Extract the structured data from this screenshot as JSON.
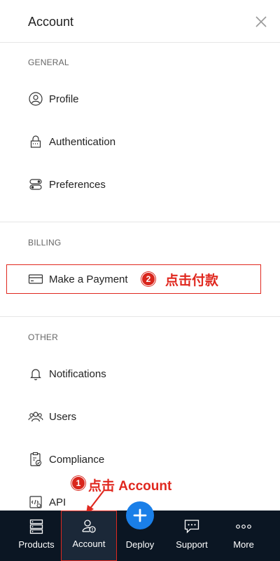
{
  "header": {
    "title": "Account"
  },
  "sections": {
    "general": {
      "label": "GENERAL",
      "items": [
        {
          "label": "Profile",
          "icon": "user-circle-icon"
        },
        {
          "label": "Authentication",
          "icon": "lock-icon"
        },
        {
          "label": "Preferences",
          "icon": "toggles-icon"
        }
      ]
    },
    "billing": {
      "label": "BILLING",
      "items": [
        {
          "label": "Make a Payment",
          "icon": "credit-card-icon"
        }
      ]
    },
    "other": {
      "label": "OTHER",
      "items": [
        {
          "label": "Notifications",
          "icon": "bell-icon"
        },
        {
          "label": "Users",
          "icon": "users-icon"
        },
        {
          "label": "Compliance",
          "icon": "clipboard-check-icon"
        },
        {
          "label": "API",
          "icon": "api-icon"
        }
      ]
    }
  },
  "annotations": {
    "step1": {
      "number": "1",
      "text": "点击 Account"
    },
    "step2": {
      "number": "2",
      "text": "点击付款"
    }
  },
  "tabbar": {
    "items": [
      {
        "label": "Products",
        "icon": "server-icon"
      },
      {
        "label": "Account",
        "icon": "account-icon"
      },
      {
        "label": "Deploy",
        "icon": "plus-icon"
      },
      {
        "label": "Support",
        "icon": "chat-icon"
      },
      {
        "label": "More",
        "icon": "more-icon"
      }
    ],
    "active": "Account"
  },
  "colors": {
    "annotation_red": "#e0281f",
    "tabbar_bg": "#0b1623",
    "deploy_blue": "#1a7fe8"
  }
}
